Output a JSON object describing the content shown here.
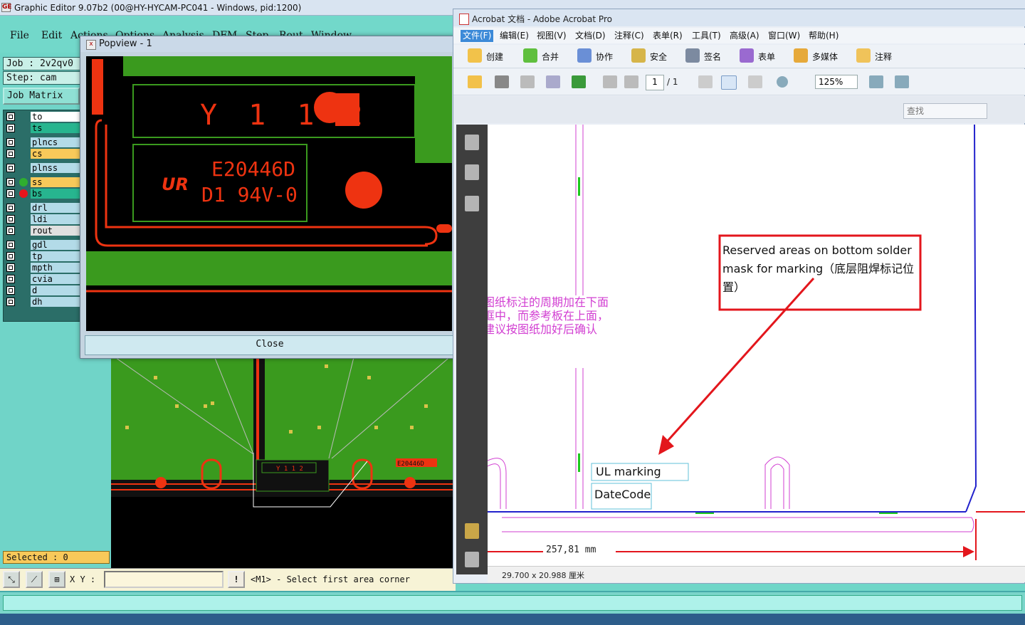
{
  "ge": {
    "title": "Graphic Editor 9.07b2 (00@HY-HYCAM-PC041 - Windows, pid:1200)",
    "app_icon": "GE",
    "menu": [
      "File",
      "Edit",
      "Actions",
      "Options",
      "Analysis",
      "DFM",
      "Step",
      "Rout",
      "Window"
    ],
    "job": "Job : 2v2qv0",
    "step": "Step: cam",
    "job_matrix": "Job Matrix",
    "layers": [
      {
        "name": "to",
        "color": "#ffffff",
        "dot": ""
      },
      {
        "name": "ts",
        "color": "#27b58f",
        "dot": ""
      },
      {
        "name": "plncs",
        "color": "#b3dbe8",
        "dot": ""
      },
      {
        "name": "cs",
        "color": "#f8c95a",
        "dot": ""
      },
      {
        "name": "plnss",
        "color": "#b3dbe8",
        "dot": ""
      },
      {
        "name": "ss",
        "color": "#f8c95a",
        "dot": "#2fae2f"
      },
      {
        "name": "bs",
        "color": "#27b58f",
        "dot": "#e8141b"
      },
      {
        "name": "drl",
        "color": "#b3dbe8",
        "dot": ""
      },
      {
        "name": "ldi",
        "color": "#b3dbe8",
        "dot": ""
      },
      {
        "name": "rout",
        "color": "#e0e0e0",
        "dot": ""
      },
      {
        "name": "gdl",
        "color": "#b3dbe8",
        "dot": ""
      },
      {
        "name": "tp",
        "color": "#b3dbe8",
        "dot": ""
      },
      {
        "name": "mpth",
        "color": "#b3dbe8",
        "dot": ""
      },
      {
        "name": "cvia",
        "color": "#b3dbe8",
        "dot": ""
      },
      {
        "name": "d",
        "color": "#b3dbe8",
        "dot": ""
      },
      {
        "name": "dh",
        "color": "#b3dbe8",
        "dot": ""
      }
    ],
    "selected": "Selected : 0",
    "xy_label": "X Y :",
    "xy_value": "",
    "warn_glyph": "!",
    "prompt": "<M1> - Select first area corner",
    "canvas_code": "E20446D",
    "canvas_small_text": "Y 1 1 2"
  },
  "popview": {
    "title": "Popview - 1",
    "close_label": "Close",
    "pcb_text1": "Y 1 1 2",
    "pcb_text2": "E20446D",
    "pcb_text3": "D1 94V-0",
    "ul_logo": "UR"
  },
  "acrobat": {
    "title": "Acrobat 文档 - Adobe Acrobat Pro",
    "menu": [
      "文件(F)",
      "编辑(E)",
      "视图(V)",
      "文档(D)",
      "注释(C)",
      "表单(R)",
      "工具(T)",
      "高级(A)",
      "窗口(W)",
      "帮助(H)"
    ],
    "toolbar1": [
      "创建",
      "合并",
      "协作",
      "安全",
      "签名",
      "表单",
      "多媒体",
      "注释"
    ],
    "page_current": "1",
    "page_total": "/ 1",
    "zoom": "125%",
    "search_placeholder": "查找",
    "status_size": "29.700 x 20.988 厘米",
    "doc": {
      "note_title": "Reserved areas on bottom solder mask for marking（底层阻焊标记位置）",
      "chinese_note": "图纸标注的周期加在下面框中，而参考板在上面，建议按图纸加好后确认",
      "ul_marking": "UL marking",
      "datecode": "DateCode",
      "dimension": "257,81 mm"
    }
  },
  "colors": {
    "pcb_green": "#3a9a1e",
    "pcb_red": "#ee1111",
    "callout_red": "#e3161c",
    "magenta": "#d23fd2"
  }
}
